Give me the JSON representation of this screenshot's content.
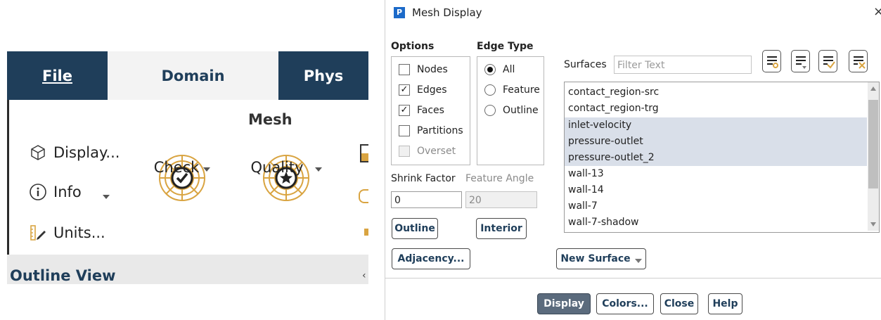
{
  "ribbon": {
    "tabs": {
      "file": "File",
      "domain": "Domain",
      "physics": "Phys"
    },
    "group_title": "Mesh",
    "display_label": "Display...",
    "info_label": "Info",
    "units_label": "Units...",
    "check_label": "Check",
    "quality_label": "Quality",
    "outline_view": "Outline View",
    "colors": {
      "tab_dark": "#1f3e5a",
      "tab_active_bg": "#f3f3f3",
      "icon_gold": "#d9a441"
    }
  },
  "dialog": {
    "title": "Mesh Display",
    "app_icon_letter": "P",
    "close_glyph": "×",
    "options": {
      "title": "Options",
      "nodes": {
        "label": "Nodes",
        "checked": false
      },
      "edges": {
        "label": "Edges",
        "checked": true
      },
      "faces": {
        "label": "Faces",
        "checked": true
      },
      "partitions": {
        "label": "Partitions",
        "checked": false
      },
      "overset": {
        "label": "Overset",
        "checked": false,
        "disabled": true
      }
    },
    "edge_type": {
      "title": "Edge Type",
      "all": "All",
      "feature": "Feature",
      "outline": "Outline",
      "selected": "All"
    },
    "shrink_factor": {
      "label": "Shrink Factor",
      "value": "0"
    },
    "feature_angle": {
      "label": "Feature Angle",
      "value": "20"
    },
    "buttons": {
      "outline": "Outline",
      "interior": "Interior",
      "adjacency": "Adjacency...",
      "new_surface": "New Surface",
      "display": "Display",
      "colors": "Colors...",
      "close": "Close",
      "help": "Help"
    },
    "surfaces": {
      "label": "Surfaces",
      "filter_placeholder": "Filter Text",
      "items": [
        {
          "name": "contact_region-src",
          "selected": false
        },
        {
          "name": "contact_region-trg",
          "selected": false
        },
        {
          "name": "inlet-velocity",
          "selected": true
        },
        {
          "name": "pressure-outlet",
          "selected": true
        },
        {
          "name": "pressure-outlet_2",
          "selected": true
        },
        {
          "name": "wall-13",
          "selected": false
        },
        {
          "name": "wall-14",
          "selected": false
        },
        {
          "name": "wall-7",
          "selected": false
        },
        {
          "name": "wall-7-shadow",
          "selected": false
        }
      ],
      "tool_icons": [
        "select-filtered-icon",
        "list-options-icon",
        "select-all-icon",
        "deselect-all-icon"
      ]
    }
  }
}
